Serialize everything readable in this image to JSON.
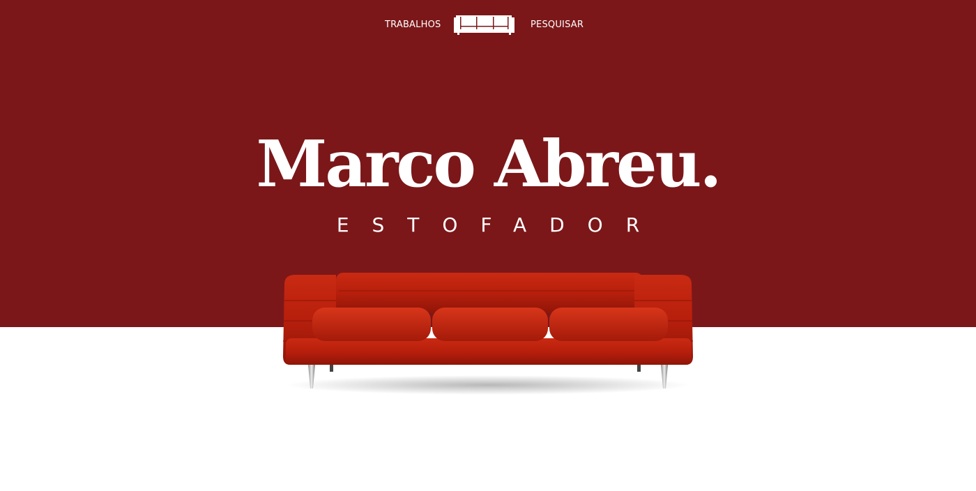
{
  "nav": {
    "left_link": "TRABALHOS",
    "right_link": "PESQUISAR",
    "logo_icon": "sofa-outline-icon"
  },
  "hero": {
    "title": "Marco Abreu.",
    "subtitle": "ESTOFADOR",
    "image": "red-velvet-sofa"
  },
  "colors": {
    "primary": "#7b1719",
    "text": "#ffffff",
    "background": "#ffffff",
    "sofa": "#c1230f"
  }
}
